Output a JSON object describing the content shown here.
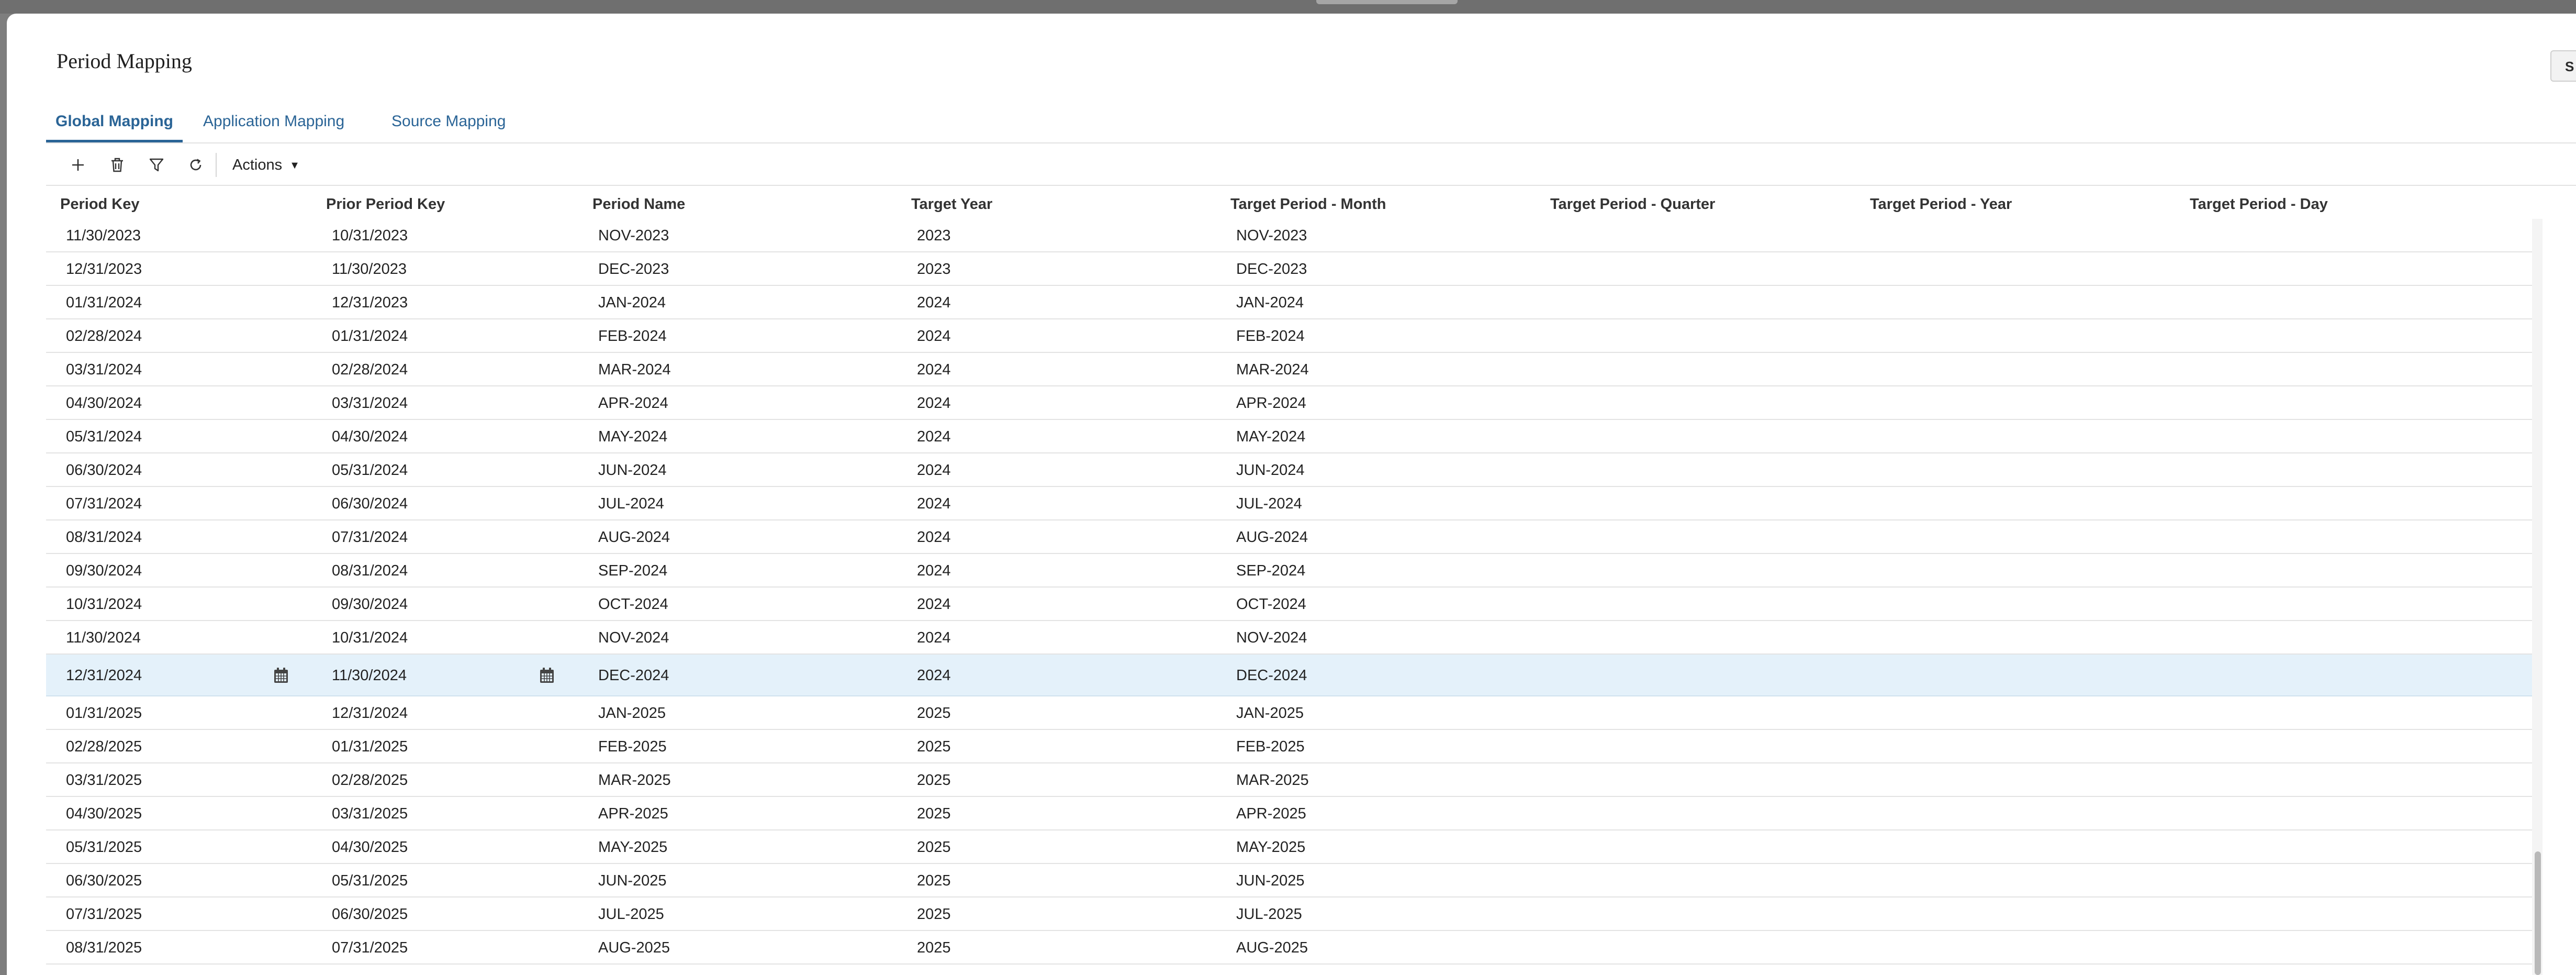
{
  "page": {
    "title": "Period Mapping",
    "save_button_label": "S"
  },
  "tabs": [
    {
      "label": "Global Mapping",
      "active": true
    },
    {
      "label": "Application Mapping",
      "active": false
    },
    {
      "label": "Source Mapping",
      "active": false
    }
  ],
  "toolbar": {
    "add_icon": "plus-icon",
    "delete_icon": "trash-icon",
    "filter_icon": "filter-icon",
    "refresh_icon": "refresh-icon",
    "actions_label": "Actions"
  },
  "columns": [
    "Period Key",
    "Prior Period Key",
    "Period Name",
    "Target Year",
    "Target Period - Month",
    "Target Period - Quarter",
    "Target Period - Year",
    "Target Period - Day"
  ],
  "rows": [
    {
      "period_key": "11/30/2023",
      "prior_period_key": "10/31/2023",
      "period_name": "NOV-2023",
      "target_year": "2023",
      "target_month": "NOV-2023",
      "target_quarter": "",
      "target_period_year": "",
      "target_day": ""
    },
    {
      "period_key": "12/31/2023",
      "prior_period_key": "11/30/2023",
      "period_name": "DEC-2023",
      "target_year": "2023",
      "target_month": "DEC-2023",
      "target_quarter": "",
      "target_period_year": "",
      "target_day": ""
    },
    {
      "period_key": "01/31/2024",
      "prior_period_key": "12/31/2023",
      "period_name": "JAN-2024",
      "target_year": "2024",
      "target_month": "JAN-2024",
      "target_quarter": "",
      "target_period_year": "",
      "target_day": ""
    },
    {
      "period_key": "02/28/2024",
      "prior_period_key": "01/31/2024",
      "period_name": "FEB-2024",
      "target_year": "2024",
      "target_month": "FEB-2024",
      "target_quarter": "",
      "target_period_year": "",
      "target_day": ""
    },
    {
      "period_key": "03/31/2024",
      "prior_period_key": "02/28/2024",
      "period_name": "MAR-2024",
      "target_year": "2024",
      "target_month": "MAR-2024",
      "target_quarter": "",
      "target_period_year": "",
      "target_day": ""
    },
    {
      "period_key": "04/30/2024",
      "prior_period_key": "03/31/2024",
      "period_name": "APR-2024",
      "target_year": "2024",
      "target_month": "APR-2024",
      "target_quarter": "",
      "target_period_year": "",
      "target_day": ""
    },
    {
      "period_key": "05/31/2024",
      "prior_period_key": "04/30/2024",
      "period_name": "MAY-2024",
      "target_year": "2024",
      "target_month": "MAY-2024",
      "target_quarter": "",
      "target_period_year": "",
      "target_day": ""
    },
    {
      "period_key": "06/30/2024",
      "prior_period_key": "05/31/2024",
      "period_name": "JUN-2024",
      "target_year": "2024",
      "target_month": "JUN-2024",
      "target_quarter": "",
      "target_period_year": "",
      "target_day": ""
    },
    {
      "period_key": "07/31/2024",
      "prior_period_key": "06/30/2024",
      "period_name": "JUL-2024",
      "target_year": "2024",
      "target_month": "JUL-2024",
      "target_quarter": "",
      "target_period_year": "",
      "target_day": ""
    },
    {
      "period_key": "08/31/2024",
      "prior_period_key": "07/31/2024",
      "period_name": "AUG-2024",
      "target_year": "2024",
      "target_month": "AUG-2024",
      "target_quarter": "",
      "target_period_year": "",
      "target_day": ""
    },
    {
      "period_key": "09/30/2024",
      "prior_period_key": "08/31/2024",
      "period_name": "SEP-2024",
      "target_year": "2024",
      "target_month": "SEP-2024",
      "target_quarter": "",
      "target_period_year": "",
      "target_day": ""
    },
    {
      "period_key": "10/31/2024",
      "prior_period_key": "09/30/2024",
      "period_name": "OCT-2024",
      "target_year": "2024",
      "target_month": "OCT-2024",
      "target_quarter": "",
      "target_period_year": "",
      "target_day": ""
    },
    {
      "period_key": "11/30/2024",
      "prior_period_key": "10/31/2024",
      "period_name": "NOV-2024",
      "target_year": "2024",
      "target_month": "NOV-2024",
      "target_quarter": "",
      "target_period_year": "",
      "target_day": ""
    },
    {
      "period_key": "12/31/2024",
      "prior_period_key": "11/30/2024",
      "period_name": "DEC-2024",
      "target_year": "2024",
      "target_month": "DEC-2024",
      "target_quarter": "",
      "target_period_year": "",
      "target_day": "",
      "selected": true
    },
    {
      "period_key": "01/31/2025",
      "prior_period_key": "12/31/2024",
      "period_name": "JAN-2025",
      "target_year": "2025",
      "target_month": "JAN-2025",
      "target_quarter": "",
      "target_period_year": "",
      "target_day": ""
    },
    {
      "period_key": "02/28/2025",
      "prior_period_key": "01/31/2025",
      "period_name": "FEB-2025",
      "target_year": "2025",
      "target_month": "FEB-2025",
      "target_quarter": "",
      "target_period_year": "",
      "target_day": ""
    },
    {
      "period_key": "03/31/2025",
      "prior_period_key": "02/28/2025",
      "period_name": "MAR-2025",
      "target_year": "2025",
      "target_month": "MAR-2025",
      "target_quarter": "",
      "target_period_year": "",
      "target_day": ""
    },
    {
      "period_key": "04/30/2025",
      "prior_period_key": "03/31/2025",
      "period_name": "APR-2025",
      "target_year": "2025",
      "target_month": "APR-2025",
      "target_quarter": "",
      "target_period_year": "",
      "target_day": ""
    },
    {
      "period_key": "05/31/2025",
      "prior_period_key": "04/30/2025",
      "period_name": "MAY-2025",
      "target_year": "2025",
      "target_month": "MAY-2025",
      "target_quarter": "",
      "target_period_year": "",
      "target_day": ""
    },
    {
      "period_key": "06/30/2025",
      "prior_period_key": "05/31/2025",
      "period_name": "JUN-2025",
      "target_year": "2025",
      "target_month": "JUN-2025",
      "target_quarter": "",
      "target_period_year": "",
      "target_day": ""
    },
    {
      "period_key": "07/31/2025",
      "prior_period_key": "06/30/2025",
      "period_name": "JUL-2025",
      "target_year": "2025",
      "target_month": "JUL-2025",
      "target_quarter": "",
      "target_period_year": "",
      "target_day": ""
    },
    {
      "period_key": "08/31/2025",
      "prior_period_key": "07/31/2025",
      "period_name": "AUG-2025",
      "target_year": "2025",
      "target_month": "AUG-2025",
      "target_quarter": "",
      "target_period_year": "",
      "target_day": ""
    }
  ],
  "icons": {
    "date_picker": "calendar-icon"
  },
  "colors": {
    "accent": "#2a6496",
    "selected_row": "#e4f1fa"
  }
}
